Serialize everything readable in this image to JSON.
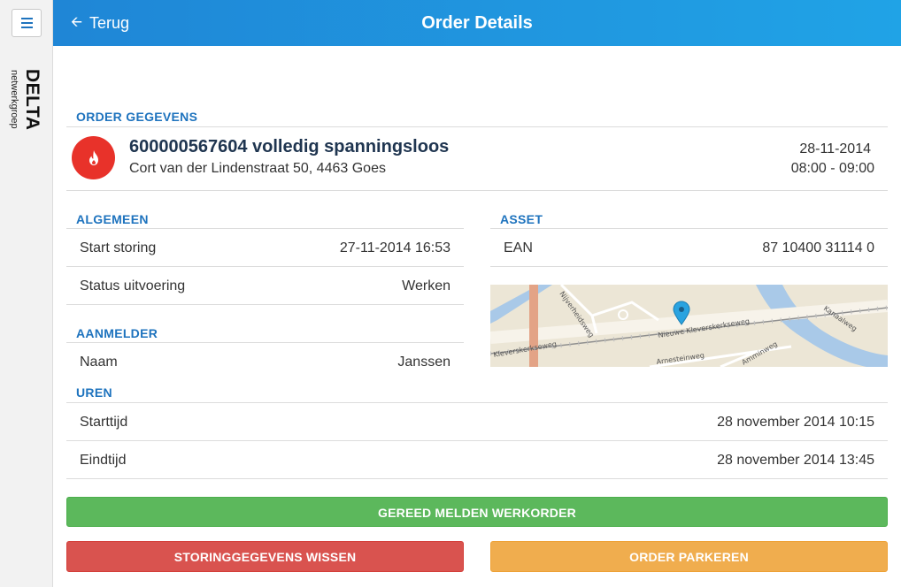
{
  "header": {
    "back_label": "Terug",
    "title": "Order Details"
  },
  "logo": {
    "main": "DELTA",
    "sub": "netwerkgroep"
  },
  "order": {
    "section_title": "ORDER GEGEVENS",
    "title": "600000567604 volledig spanningsloos",
    "address": "Cort van der Lindenstraat 50, 4463 Goes",
    "date": "28-11-2014",
    "time": "08:00 - 09:00",
    "icon": "flame-icon"
  },
  "algemeen": {
    "section_title": "ALGEMEEN",
    "rows": [
      {
        "label": "Start storing",
        "value": "27-11-2014 16:53"
      },
      {
        "label": "Status uitvoering",
        "value": "Werken"
      }
    ]
  },
  "asset": {
    "section_title": "ASSET",
    "rows": [
      {
        "label": "EAN",
        "value": "87 10400 31114 0"
      }
    ],
    "map_streets": [
      "Nijverheidsweg",
      "Nieuwe Kleverskerkseweg",
      "Kleverskerkseweg",
      "Arnesteinweg",
      "Kanaalweg",
      "Amminweg"
    ]
  },
  "aanmelder": {
    "section_title": "AANMELDER",
    "rows": [
      {
        "label": "Naam",
        "value": "Janssen"
      }
    ]
  },
  "uren": {
    "section_title": "UREN",
    "rows": [
      {
        "label": "Starttijd",
        "value": "28 november 2014 10:15"
      },
      {
        "label": "Eindtijd",
        "value": "28 november 2014 13:45"
      }
    ]
  },
  "actions": {
    "complete": "GEREED MELDEN WERKORDER",
    "clear": "STORINGGEGEVENS WISSEN",
    "park": "ORDER PARKEREN"
  },
  "colors": {
    "header_start": "#1f86d6",
    "header_end": "#20a3e6",
    "section_title": "#1e73be",
    "success": "#5cb85c",
    "danger": "#d9534f",
    "warning": "#f0ad4e",
    "order_icon": "#e8322a"
  }
}
